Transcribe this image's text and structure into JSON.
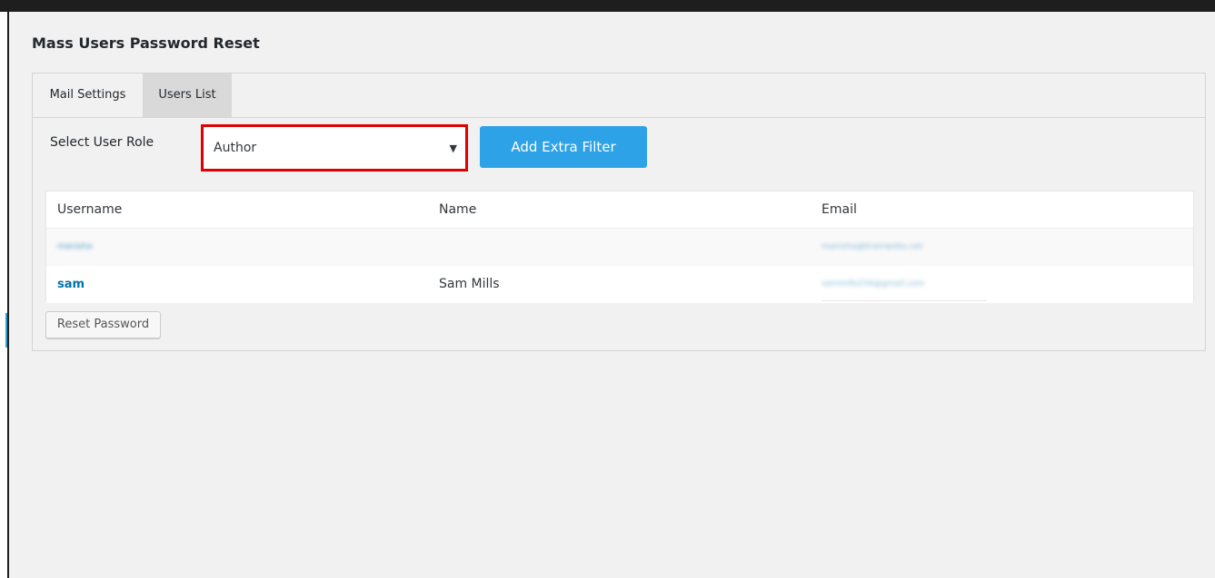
{
  "page": {
    "title": "Mass Users Password Reset"
  },
  "tabs": [
    {
      "label": "Mail Settings"
    },
    {
      "label": "Users List"
    }
  ],
  "filter": {
    "role_label": "Select User Role",
    "selected_role": "Author",
    "add_filter_label": "Add Extra Filter"
  },
  "table": {
    "columns": [
      "Username",
      "Name",
      "Email"
    ],
    "rows": [
      {
        "username": "manisha",
        "name": "",
        "email": "manisha@brainwebs.net"
      },
      {
        "username": "sam",
        "name": "Sam Mills",
        "email": "sammills234@gmail.com"
      }
    ]
  },
  "actions": {
    "reset_label": "Reset Password"
  },
  "colors": {
    "accent": "#2ea2e6",
    "highlight_border": "#e00000",
    "link": "#0073aa"
  }
}
